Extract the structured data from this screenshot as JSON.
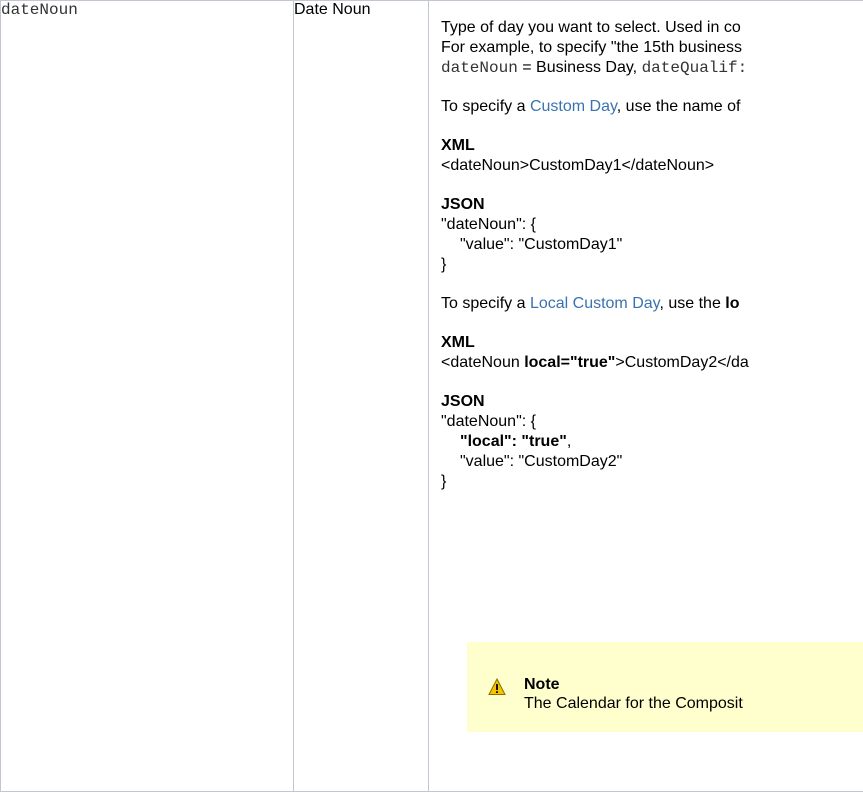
{
  "row": {
    "param_name": "dateNoun",
    "label": "Date Noun",
    "description": {
      "line1": "Type of day you want to select. Used in co",
      "line2": "For example, to specify \"the 15th business",
      "line3_code1": "dateNoun",
      "line3_text": " = Business Day, ",
      "line3_code2": "dateQualif:",
      "custom_day_prefix": "To specify a ",
      "custom_day_link": "Custom Day",
      "custom_day_suffix": ", use the name of",
      "xml_heading_1": "XML",
      "xml_code_1": "<dateNoun>CustomDay1</dateNoun>",
      "json_heading_1": "JSON",
      "json_1_open": "\"dateNoun\": {",
      "json_1_value": "\"value\": \"CustomDay1\"",
      "json_1_close": "}",
      "local_day_prefix": "To specify a ",
      "local_day_link": "Local Custom Day",
      "local_day_suffix": ", use the ",
      "local_day_bold": "lo",
      "xml_heading_2": "XML",
      "xml_2_start": "<dateNoun ",
      "xml_2_bold": "local=\"true\"",
      "xml_2_end": ">CustomDay2</da",
      "json_heading_2": "JSON",
      "json_2_open": "\"dateNoun\": {",
      "json_2_local_bold": "\"local\": \"true\"",
      "json_2_local_comma": ",",
      "json_2_value": "\"value\": \"CustomDay2\"",
      "json_2_close": "}"
    },
    "note": {
      "icon": "warning-icon",
      "title": "Note",
      "body": "The Calendar for the Composit"
    }
  },
  "colors": {
    "link": "#3b73af",
    "note_background": "#ffffce",
    "border": "#c1c7d0"
  }
}
